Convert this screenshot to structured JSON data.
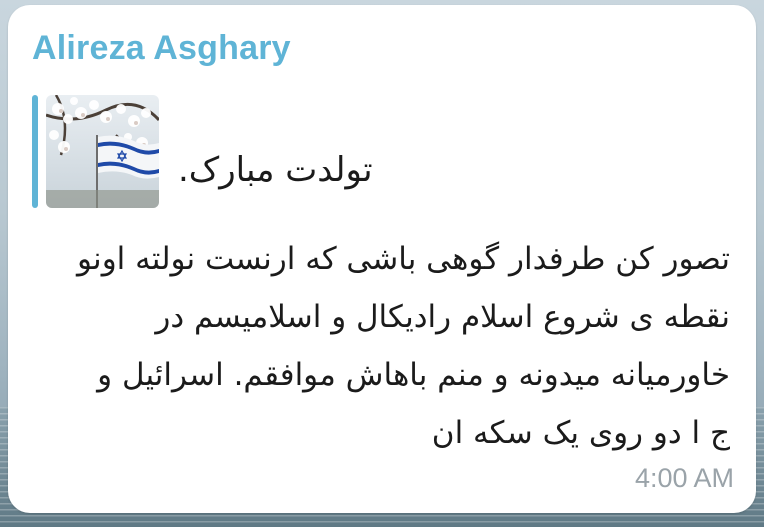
{
  "message": {
    "sender": "Alireza Asghary",
    "reply": {
      "text": "تولدت مبارک."
    },
    "text_lines": [
      "تصور کن طرفدار گوهی باشی که ارنست نولته اونو",
      "نقطه ی شروع اسلام رادیکال و اسلامیسم در",
      "خاورمیانه میدونه و منم باهاش موافقم. اسرائیل و",
      "ج ا دو روی یک سکه ان"
    ],
    "time": "4:00 AM"
  },
  "colors": {
    "sender": "#5fb4d6",
    "reply_bar": "#5fb4d6",
    "text": "#1b1b1b",
    "time": "#9aa3a9"
  },
  "icons": {
    "reply_thumbnail": "flag-photo-thumbnail"
  }
}
